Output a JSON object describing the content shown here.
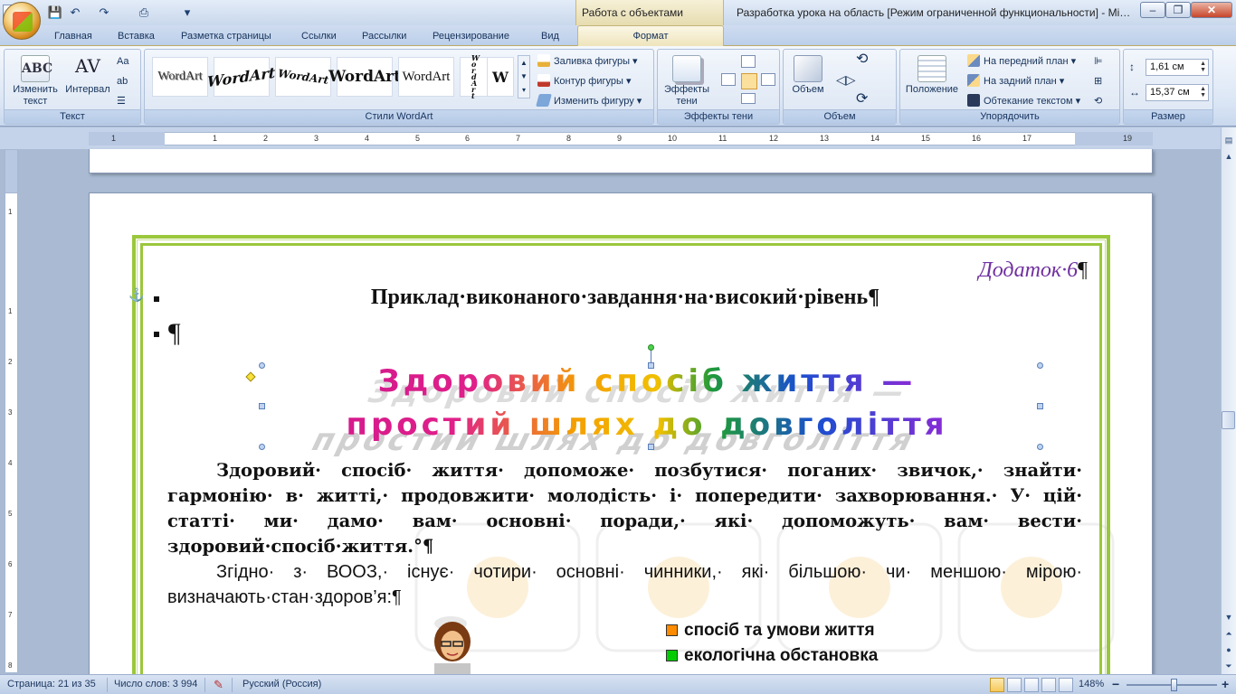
{
  "titlebar": {
    "context_tab_title": "Работа с объектами WordArt",
    "doc_title": "Разработка урока на область [Режим ограниченной функциональности] - Mi…",
    "minimize": "–",
    "restore": "❐",
    "close": "✕"
  },
  "quick_access": {
    "save": "💾",
    "undo": "↶",
    "redo": "↷",
    "print": "⎙",
    "more": "▾"
  },
  "tabs": [
    "Главная",
    "Вставка",
    "Разметка страницы",
    "Ссылки",
    "Рассылки",
    "Рецензирование",
    "Вид"
  ],
  "active_tab": "Формат",
  "ribbon": {
    "text_group": {
      "label": "Текст",
      "edit_text": "Изменить текст",
      "spacing": "Интервал"
    },
    "wordart_styles": {
      "label": "Стили WordArt",
      "gallery": [
        "WordArt",
        "WordArt",
        "WordArt",
        "WordArt",
        "WordArt",
        "W o r d A r t",
        "W"
      ],
      "fill": "Заливка фигуры ▾",
      "outline": "Контур фигуры ▾",
      "change_shape": "Изменить фигуру ▾"
    },
    "shadow": {
      "label": "Эффекты тени",
      "button": "Эффекты тени"
    },
    "volume": {
      "label": "Объем",
      "button": "Объем"
    },
    "arrange": {
      "label": "Упорядочить",
      "position": "Положение",
      "bring_front": "На передний план ▾",
      "send_back": "На задний план ▾",
      "wrap": "Обтекание текстом ▾"
    },
    "size": {
      "label": "Размер",
      "height": "1,61 см",
      "width": "15,37 см"
    }
  },
  "ruler": {
    "h_numbers": [
      "1",
      "1",
      "2",
      "3",
      "4",
      "5",
      "6",
      "7",
      "8",
      "9",
      "10",
      "11",
      "12",
      "13",
      "14",
      "15",
      "16",
      "17",
      "19"
    ],
    "v_numbers": [
      "1",
      "1",
      "2",
      "3",
      "4",
      "5",
      "6",
      "7",
      "8"
    ]
  },
  "document": {
    "addendum": "Додаток·6",
    "pilcrow": "¶",
    "heading": "Приклад·виконаного·завдання·на·високий·рівень",
    "wordart_line1": "Здоровий спосіб життя —",
    "wordart_line2": "простий шлях до довголіття",
    "para1": "Здоровий· спосіб· життя· допоможе· позбутися· поганих· звичок,· знайти· гармонію· в· житті,· продовжити· молодість· і· попередити· захворювання.· У· цій· статті· ми· дамо· вам· основні· поради,· які· допоможуть· вам· вести· здоровий·спосіб·життя.°¶",
    "para2": "Згідно· з· ВООЗ,· існує· чотири· основні· чинники,· які· більшою· чи· меншою· мірою· визначають·стан·здоров’я:¶",
    "legend": [
      {
        "label": "спосіб та умови життя",
        "color": "#ff8c00"
      },
      {
        "label": "екологічна обстановка",
        "color": "#00cc00"
      }
    ]
  },
  "statusbar": {
    "page": "Страница: 21 из 35",
    "words": "Число слов: 3 994",
    "language": "Русский (Россия)",
    "zoom": "148%",
    "zoom_minus": "−",
    "zoom_plus": "+"
  },
  "colors": {
    "border_green": "#9bc73c",
    "addendum_purple": "#7030a0",
    "accent_blue": "#15325a"
  }
}
